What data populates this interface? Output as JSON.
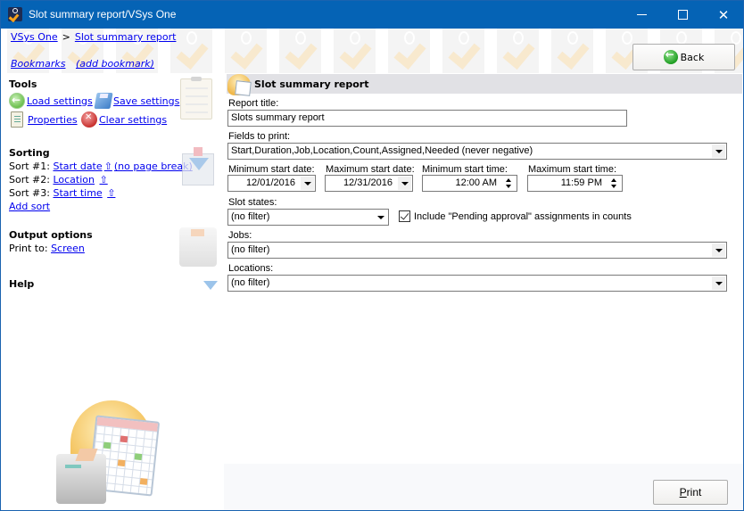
{
  "window": {
    "title": "Slot summary report/VSys One",
    "controls": {
      "minimize": "minimize",
      "maximize": "maximize",
      "close": "close"
    }
  },
  "header": {
    "breadcrumb": [
      {
        "label": "VSys One"
      },
      {
        "label": "Slot summary report"
      }
    ],
    "breadcrumb_separator": ">",
    "bookmarks_label": "Bookmarks",
    "add_bookmark_label": "(add bookmark)",
    "back_label": "Back"
  },
  "sidebar": {
    "tools": {
      "title": "Tools",
      "items": [
        {
          "label": "Load settings",
          "icon": "load-icon"
        },
        {
          "label": "Save settings",
          "icon": "save-icon"
        },
        {
          "label": "Properties",
          "icon": "properties-icon"
        },
        {
          "label": "Clear settings",
          "icon": "clear-icon"
        }
      ]
    },
    "sorting": {
      "title": "Sorting",
      "sorts": [
        {
          "prefix": "Sort #1:",
          "field": "Start date",
          "direction": "⇧",
          "extra": "(no page break)"
        },
        {
          "prefix": "Sort #2:",
          "field": "Location",
          "direction": "⇧"
        },
        {
          "prefix": "Sort #3:",
          "field": "Start time",
          "direction": "⇧"
        }
      ],
      "add_sort_label": "Add sort"
    },
    "output": {
      "title": "Output options",
      "print_to_label": "Print to:",
      "print_to_value": "Screen"
    },
    "help": {
      "title": "Help"
    }
  },
  "main": {
    "section_title": "Slot summary report",
    "report_title": {
      "label": "Report title:",
      "value": "Slots summary report"
    },
    "fields_to_print": {
      "label": "Fields to print:",
      "value": "Start,Duration,Job,Location,Count,Assigned,Needed (never negative)"
    },
    "min_start_date": {
      "label": "Minimum start date:",
      "value": "12/01/2016"
    },
    "max_start_date": {
      "label": "Maximum start date:",
      "value": "12/31/2016"
    },
    "min_start_time": {
      "label": "Minimum start time:",
      "value": "12:00 AM"
    },
    "max_start_time": {
      "label": "Maximum start time:",
      "value": "11:59 PM"
    },
    "slot_states": {
      "label": "Slot states:",
      "value": "(no filter)"
    },
    "include_pending": {
      "label": "Include \"Pending approval\" assignments in counts",
      "checked": true
    },
    "jobs": {
      "label": "Jobs:",
      "value": "(no filter)"
    },
    "locations": {
      "label": "Locations:",
      "value": "(no filter)"
    }
  },
  "footer": {
    "print_accel": "P",
    "print_rest": "rint"
  }
}
